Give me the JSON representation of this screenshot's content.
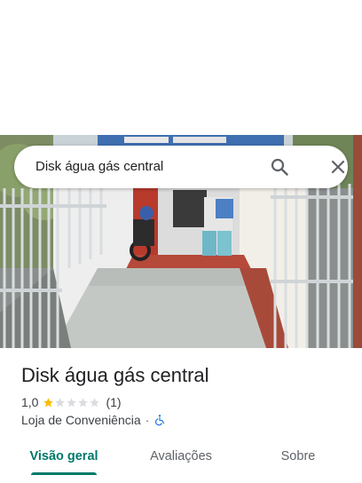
{
  "search": {
    "query": "Disk água gás central"
  },
  "place": {
    "name": "Disk água gás central",
    "rating": "1,0",
    "rating_value": 1,
    "rating_max": 5,
    "review_count": "(1)",
    "category": "Loja de Conveniência",
    "separator": "·"
  },
  "tabs": [
    {
      "label": "Visão geral",
      "active": true
    },
    {
      "label": "Avaliações",
      "active": false
    },
    {
      "label": "Sobre",
      "active": false
    }
  ],
  "icons": {
    "search": "search-icon",
    "close": "close-icon",
    "accessibility": "wheelchair-icon",
    "star": "star-icon"
  },
  "colors": {
    "accent": "#00796b",
    "star_filled": "#fbbc04",
    "star_empty": "#dadce0",
    "accessibility": "#1a73e8"
  }
}
